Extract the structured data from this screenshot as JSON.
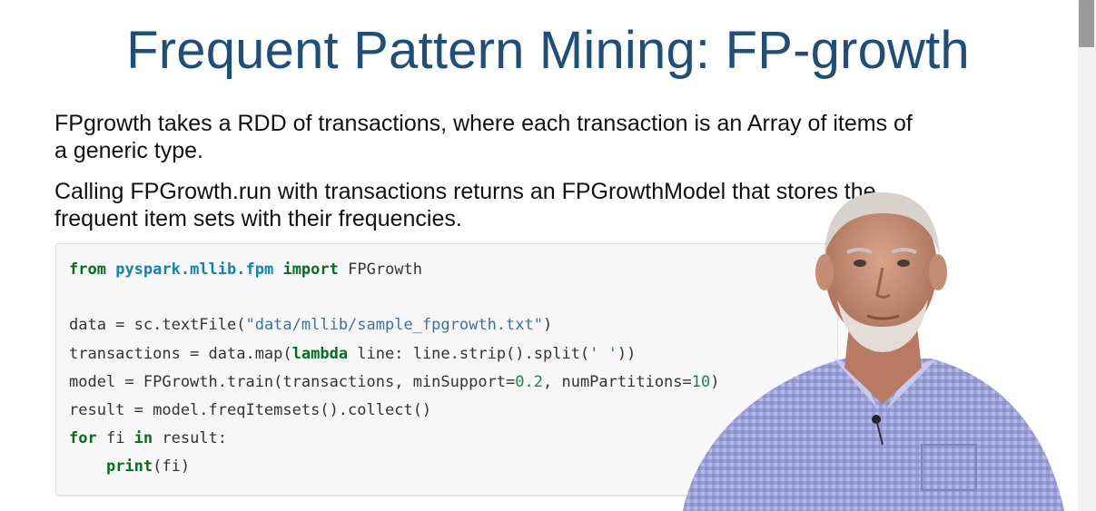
{
  "slide": {
    "title": "Frequent Pattern Mining: FP-growth",
    "paragraphs": [
      "FPgrowth takes a RDD of transactions, where each transaction is an Array of items of a generic type.",
      "Calling FPGrowth.run with transactions returns an FPGrowthModel that stores the frequent item sets with their frequencies."
    ]
  },
  "code": {
    "line1": {
      "kw1": "from",
      "module": "pyspark.mllib.fpm",
      "kw2": "import",
      "name": "FPGrowth"
    },
    "line2": {
      "pre": "data = sc.textFile(",
      "str": "\"data/mllib/sample_fpgrowth.txt\"",
      "post": ")"
    },
    "line3": {
      "pre": "transactions = data.map(",
      "kw": "lambda",
      "mid": " line: line.strip().split(",
      "str": "' '",
      "post": "))"
    },
    "line4": {
      "pre": "model = FPGrowth.train(transactions, minSupport=",
      "num1": "0.2",
      "mid": ", numPartitions=",
      "num2": "10",
      "post": ")"
    },
    "line5": {
      "text": "result = model.freqItemsets().collect()"
    },
    "line6": {
      "kw1": "for",
      "mid": " fi ",
      "kw2": "in",
      "post": " result:"
    },
    "line7": {
      "indent": "    ",
      "kw": "print",
      "post": "(fi)"
    }
  },
  "colors": {
    "title": "#1f4e79",
    "keyword": "#007020",
    "module": "#0e84b5",
    "string": "#4070a0",
    "number": "#208050",
    "code_bg": "#f7f7f7"
  }
}
